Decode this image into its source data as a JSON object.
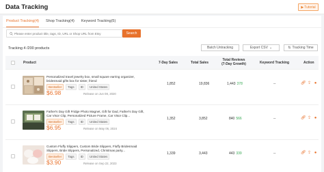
{
  "header": {
    "title": "Data Tracking",
    "tutorial_label": "Tutorial"
  },
  "tabs": [
    {
      "label": "Product Tracking(4)",
      "active": true
    },
    {
      "label": "Shop Tracking(4)",
      "active": false
    },
    {
      "label": "Keyword Tracking(5)",
      "active": false
    }
  ],
  "search": {
    "placeholder": "Please enter product title, tags, ID, URL or Shop URL from Etsy",
    "button_label": "Search"
  },
  "toolbar": {
    "count_label": "Tracking 4 /200 products",
    "batch_untrack_label": "Batch Untracking",
    "export_label": "Export CSV",
    "sort_label": "Tracking Time"
  },
  "table": {
    "columns": [
      "Product",
      "7-Day Sales",
      "Total Sales",
      "Total Reviews (7-Day Growth)",
      "Keyword Tracking",
      "Action"
    ],
    "rows": [
      {
        "title": "Personalized travel jewelry box, small square earring organizer, bridesmaid gifts box for sister, friend",
        "tags": [
          "Bestseller",
          "Tags",
          "ID",
          "United States"
        ],
        "price": "$6.98",
        "release": "Release on Jun 08, 2020",
        "sales7": "1,852",
        "total_sales": "19,836",
        "reviews": "1,443",
        "growth": "378",
        "keyword": "--"
      },
      {
        "title": "Father's Day Gift Fridge Photo Magnet, Gift for Dad, Father's Day Gift, Car Visor Clip, Personalized Picture Frame, Car Visor Clip...",
        "tags": [
          "Bestseller",
          "Tags",
          "ID",
          "United States"
        ],
        "price": "$6.95",
        "release": "Release on May 06, 2024",
        "sales7": "1,352",
        "total_sales": "3,852",
        "reviews": "840",
        "growth": "566",
        "keyword": "--"
      },
      {
        "title": "Custom Fluffy Slippers, Custom Bride Slippers, Fluffy Bridesmaid Slippers, Bride Slippers, Personalized, Christmas party...",
        "tags": [
          "Bestseller",
          "Tags",
          "ID",
          "United States"
        ],
        "price": "$3.90",
        "release": "Release on Sep 22, 2023",
        "sales7": "1,339",
        "total_sales": "3,443",
        "reviews": "443",
        "growth": "339",
        "keyword": "--"
      }
    ]
  },
  "colors": {
    "accent": "#e8722c",
    "growth": "#36a852"
  }
}
